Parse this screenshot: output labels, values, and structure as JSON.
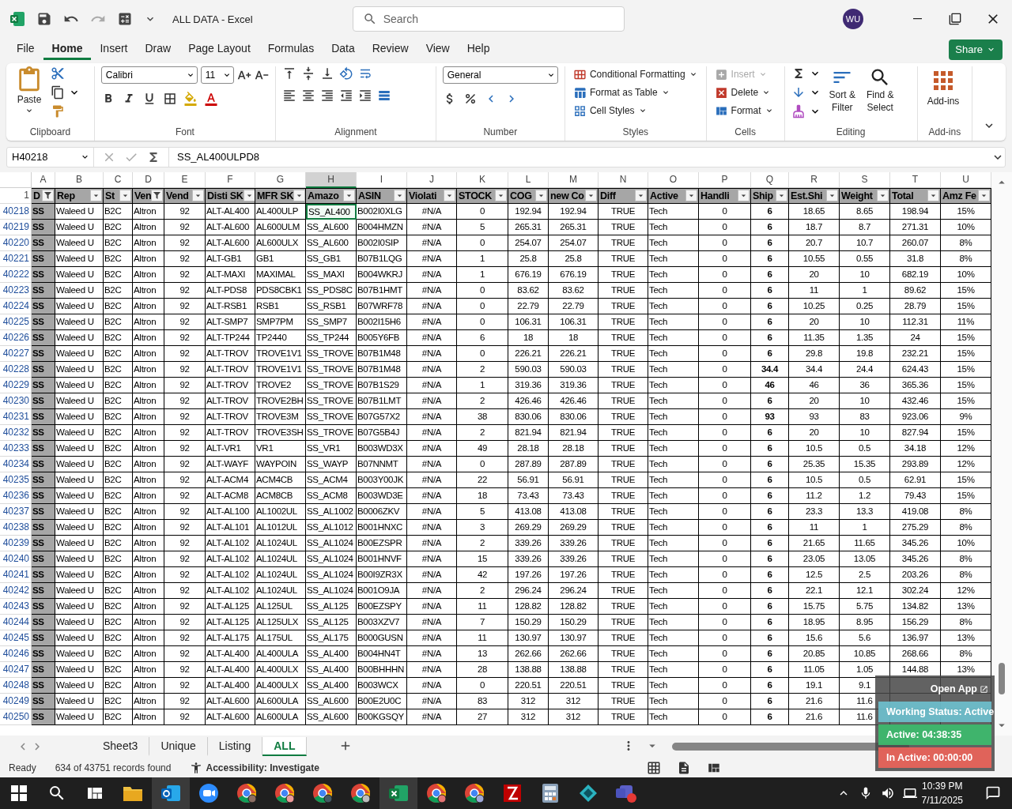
{
  "window": {
    "title": "ALL DATA - Excel",
    "search_placeholder": "Search",
    "avatar": "WU"
  },
  "menu_tabs": [
    {
      "label": "File",
      "selected": false
    },
    {
      "label": "Home",
      "selected": true
    },
    {
      "label": "Insert",
      "selected": false
    },
    {
      "label": "Draw",
      "selected": false
    },
    {
      "label": "Page Layout",
      "selected": false
    },
    {
      "label": "Formulas",
      "selected": false
    },
    {
      "label": "Data",
      "selected": false
    },
    {
      "label": "Review",
      "selected": false
    },
    {
      "label": "View",
      "selected": false
    },
    {
      "label": "Help",
      "selected": false
    }
  ],
  "share_button": "Share",
  "ribbon": {
    "clipboard": {
      "label": "Clipboard",
      "paste": "Paste"
    },
    "font": {
      "label": "Font",
      "family": "Calibri",
      "size": "11"
    },
    "alignment": {
      "label": "Alignment"
    },
    "number": {
      "label": "Number",
      "format": "General"
    },
    "styles": {
      "label": "Styles",
      "items": [
        "Conditional Formatting",
        "Format as Table",
        "Cell Styles"
      ]
    },
    "cells": {
      "label": "Cells",
      "items": [
        {
          "label": "Insert",
          "disabled": true
        },
        {
          "label": "Delete",
          "disabled": false
        },
        {
          "label": "Format",
          "disabled": false
        }
      ]
    },
    "editing": {
      "label": "Editing",
      "sort": [
        "Sort &",
        "Filter"
      ],
      "find": [
        "Find &",
        "Select"
      ]
    },
    "addins": {
      "label": "Add-ins",
      "button": "Add-ins"
    }
  },
  "formula_bar": {
    "name_box": "H40218",
    "content": "SS_AL400ULPD8"
  },
  "columns": [
    {
      "letter": "A",
      "header": "D",
      "filtered": true,
      "selected": false
    },
    {
      "letter": "B",
      "header": "Rep",
      "filtered": false,
      "selected": false
    },
    {
      "letter": "C",
      "header": "St",
      "filtered": false,
      "selected": false
    },
    {
      "letter": "D",
      "header": "Ven",
      "filtered": true,
      "selected": false
    },
    {
      "letter": "E",
      "header": "Vend",
      "filtered": false,
      "selected": false
    },
    {
      "letter": "F",
      "header": "Disti SK",
      "filtered": false,
      "selected": false
    },
    {
      "letter": "G",
      "header": "MFR SK",
      "filtered": false,
      "selected": false
    },
    {
      "letter": "H",
      "header": "Amazo",
      "filtered": false,
      "selected": true
    },
    {
      "letter": "I",
      "header": "ASIN",
      "filtered": false,
      "selected": false
    },
    {
      "letter": "J",
      "header": "Violati",
      "filtered": false,
      "selected": false
    },
    {
      "letter": "K",
      "header": "STOCK",
      "filtered": false,
      "selected": false
    },
    {
      "letter": "L",
      "header": "COG",
      "filtered": false,
      "selected": false
    },
    {
      "letter": "M",
      "header": "new Co",
      "filtered": false,
      "selected": false
    },
    {
      "letter": "N",
      "header": "Diff",
      "filtered": false,
      "selected": false
    },
    {
      "letter": "O",
      "header": "Active",
      "filtered": false,
      "selected": false
    },
    {
      "letter": "P",
      "header": "Handli",
      "filtered": false,
      "selected": false
    },
    {
      "letter": "Q",
      "header": "Ship",
      "filtered": false,
      "selected": false
    },
    {
      "letter": "R",
      "header": "Est.Shi",
      "filtered": false,
      "selected": false
    },
    {
      "letter": "S",
      "header": "Weight",
      "filtered": false,
      "selected": false
    },
    {
      "letter": "T",
      "header": "Total",
      "filtered": false,
      "selected": false
    },
    {
      "letter": "U",
      "header": "Amz Fe",
      "filtered": false,
      "selected": false
    }
  ],
  "header_row_number": "1",
  "rows": [
    {
      "num": "40218",
      "selected": true,
      "cells": [
        "SS",
        "Waleed U",
        "B2C",
        "Altron",
        "92",
        "ALT-AL400",
        "AL400ULP",
        "SS_AL400",
        "B002I0XLG",
        "#N/A",
        "0",
        "192.94",
        "192.94",
        "TRUE",
        "Tech",
        "0",
        "6",
        "18.65",
        "8.65",
        "198.94",
        "15%"
      ]
    },
    {
      "num": "40219",
      "selected": false,
      "cells": [
        "SS",
        "Waleed U",
        "B2C",
        "Altron",
        "92",
        "ALT-AL600",
        "AL600ULM",
        "SS_AL600",
        "B004HMZN",
        "#N/A",
        "5",
        "265.31",
        "265.31",
        "TRUE",
        "Tech",
        "0",
        "6",
        "18.7",
        "8.7",
        "271.31",
        "10%"
      ]
    },
    {
      "num": "40220",
      "selected": false,
      "cells": [
        "SS",
        "Waleed U",
        "B2C",
        "Altron",
        "92",
        "ALT-AL600",
        "AL600ULX",
        "SS_AL600",
        "B002I0SIP",
        "#N/A",
        "0",
        "254.07",
        "254.07",
        "TRUE",
        "Tech",
        "0",
        "6",
        "20.7",
        "10.7",
        "260.07",
        "8%"
      ]
    },
    {
      "num": "40221",
      "selected": false,
      "cells": [
        "SS",
        "Waleed U",
        "B2C",
        "Altron",
        "92",
        "ALT-GB1",
        "GB1",
        "SS_GB1",
        "B07B1LQG",
        "#N/A",
        "1",
        "25.8",
        "25.8",
        "TRUE",
        "Tech",
        "0",
        "6",
        "10.55",
        "0.55",
        "31.8",
        "8%"
      ]
    },
    {
      "num": "40222",
      "selected": false,
      "cells": [
        "SS",
        "Waleed U",
        "B2C",
        "Altron",
        "92",
        "ALT-MAXI",
        "MAXIMAL",
        "SS_MAXI",
        "B004WKRJ",
        "#N/A",
        "1",
        "676.19",
        "676.19",
        "TRUE",
        "Tech",
        "0",
        "6",
        "20",
        "10",
        "682.19",
        "10%"
      ]
    },
    {
      "num": "40223",
      "selected": false,
      "cells": [
        "SS",
        "Waleed U",
        "B2C",
        "Altron",
        "92",
        "ALT-PDS8",
        "PDS8CBK1",
        "SS_PDS8C",
        "B07B1HMT",
        "#N/A",
        "0",
        "83.62",
        "83.62",
        "TRUE",
        "Tech",
        "0",
        "6",
        "11",
        "1",
        "89.62",
        "15%"
      ]
    },
    {
      "num": "40224",
      "selected": false,
      "cells": [
        "SS",
        "Waleed U",
        "B2C",
        "Altron",
        "92",
        "ALT-RSB1",
        "RSB1",
        "SS_RSB1",
        "B07WRF78",
        "#N/A",
        "0",
        "22.79",
        "22.79",
        "TRUE",
        "Tech",
        "0",
        "6",
        "10.25",
        "0.25",
        "28.79",
        "15%"
      ]
    },
    {
      "num": "40225",
      "selected": false,
      "cells": [
        "SS",
        "Waleed U",
        "B2C",
        "Altron",
        "92",
        "ALT-SMP7",
        "SMP7PM",
        "SS_SMP7",
        "B002I15H6",
        "#N/A",
        "0",
        "106.31",
        "106.31",
        "TRUE",
        "Tech",
        "0",
        "6",
        "20",
        "10",
        "112.31",
        "11%"
      ]
    },
    {
      "num": "40226",
      "selected": false,
      "cells": [
        "SS",
        "Waleed U",
        "B2C",
        "Altron",
        "92",
        "ALT-TP244",
        "TP2440",
        "SS_TP244",
        "B005Y6FB",
        "#N/A",
        "6",
        "18",
        "18",
        "TRUE",
        "Tech",
        "0",
        "6",
        "11.35",
        "1.35",
        "24",
        "15%"
      ]
    },
    {
      "num": "40227",
      "selected": false,
      "cells": [
        "SS",
        "Waleed U",
        "B2C",
        "Altron",
        "92",
        "ALT-TROV",
        "TROVE1V1",
        "SS_TROVE",
        "B07B1M48",
        "#N/A",
        "0",
        "226.21",
        "226.21",
        "TRUE",
        "Tech",
        "0",
        "6",
        "29.8",
        "19.8",
        "232.21",
        "15%"
      ]
    },
    {
      "num": "40228",
      "selected": false,
      "cells": [
        "SS",
        "Waleed U",
        "B2C",
        "Altron",
        "92",
        "ALT-TROV",
        "TROVE1V1",
        "SS_TROVE",
        "B07B1M48",
        "#N/A",
        "2",
        "590.03",
        "590.03",
        "TRUE",
        "Tech",
        "0",
        "34.4",
        "34.4",
        "24.4",
        "624.43",
        "15%"
      ]
    },
    {
      "num": "40229",
      "selected": false,
      "cells": [
        "SS",
        "Waleed U",
        "B2C",
        "Altron",
        "92",
        "ALT-TROV",
        "TROVE2",
        "SS_TROVE",
        "B07B1S29",
        "#N/A",
        "1",
        "319.36",
        "319.36",
        "TRUE",
        "Tech",
        "0",
        "46",
        "46",
        "36",
        "365.36",
        "15%"
      ]
    },
    {
      "num": "40230",
      "selected": false,
      "cells": [
        "SS",
        "Waleed U",
        "B2C",
        "Altron",
        "92",
        "ALT-TROV",
        "TROVE2BH",
        "SS_TROVE",
        "B07B1LMT",
        "#N/A",
        "2",
        "426.46",
        "426.46",
        "TRUE",
        "Tech",
        "0",
        "6",
        "20",
        "10",
        "432.46",
        "15%"
      ]
    },
    {
      "num": "40231",
      "selected": false,
      "cells": [
        "SS",
        "Waleed U",
        "B2C",
        "Altron",
        "92",
        "ALT-TROV",
        "TROVE3M",
        "SS_TROVE",
        "B07G57X2",
        "#N/A",
        "38",
        "830.06",
        "830.06",
        "TRUE",
        "Tech",
        "0",
        "93",
        "93",
        "83",
        "923.06",
        "9%"
      ]
    },
    {
      "num": "40232",
      "selected": false,
      "cells": [
        "SS",
        "Waleed U",
        "B2C",
        "Altron",
        "92",
        "ALT-TROV",
        "TROVE3SH",
        "SS_TROVE",
        "B07G5B4J",
        "#N/A",
        "2",
        "821.94",
        "821.94",
        "TRUE",
        "Tech",
        "0",
        "6",
        "20",
        "10",
        "827.94",
        "15%"
      ]
    },
    {
      "num": "40233",
      "selected": false,
      "cells": [
        "SS",
        "Waleed U",
        "B2C",
        "Altron",
        "92",
        "ALT-VR1",
        "VR1",
        "SS_VR1",
        "B003WD3X",
        "#N/A",
        "49",
        "28.18",
        "28.18",
        "TRUE",
        "Tech",
        "0",
        "6",
        "10.5",
        "0.5",
        "34.18",
        "12%"
      ]
    },
    {
      "num": "40234",
      "selected": false,
      "cells": [
        "SS",
        "Waleed U",
        "B2C",
        "Altron",
        "92",
        "ALT-WAYF",
        "WAYPOIN",
        "SS_WAYP",
        "B07NNMT",
        "#N/A",
        "0",
        "287.89",
        "287.89",
        "TRUE",
        "Tech",
        "0",
        "6",
        "25.35",
        "15.35",
        "293.89",
        "12%"
      ]
    },
    {
      "num": "40235",
      "selected": false,
      "cells": [
        "SS",
        "Waleed U",
        "B2C",
        "Altron",
        "92",
        "ALT-ACM4",
        "ACM4CB",
        "SS_ACM4",
        "B003Y00JK",
        "#N/A",
        "22",
        "56.91",
        "56.91",
        "TRUE",
        "Tech",
        "0",
        "6",
        "10.5",
        "0.5",
        "62.91",
        "15%"
      ]
    },
    {
      "num": "40236",
      "selected": false,
      "cells": [
        "SS",
        "Waleed U",
        "B2C",
        "Altron",
        "92",
        "ALT-ACM8",
        "ACM8CB",
        "SS_ACM8",
        "B003WD3E",
        "#N/A",
        "18",
        "73.43",
        "73.43",
        "TRUE",
        "Tech",
        "0",
        "6",
        "11.2",
        "1.2",
        "79.43",
        "15%"
      ]
    },
    {
      "num": "40237",
      "selected": false,
      "cells": [
        "SS",
        "Waleed U",
        "B2C",
        "Altron",
        "92",
        "ALT-AL100",
        "AL1002UL",
        "SS_AL1002",
        "B0006ZKV",
        "#N/A",
        "5",
        "413.08",
        "413.08",
        "TRUE",
        "Tech",
        "0",
        "6",
        "23.3",
        "13.3",
        "419.08",
        "8%"
      ]
    },
    {
      "num": "40238",
      "selected": false,
      "cells": [
        "SS",
        "Waleed U",
        "B2C",
        "Altron",
        "92",
        "ALT-AL101",
        "AL1012UL",
        "SS_AL1012",
        "B001HNXC",
        "#N/A",
        "3",
        "269.29",
        "269.29",
        "TRUE",
        "Tech",
        "0",
        "6",
        "11",
        "1",
        "275.29",
        "8%"
      ]
    },
    {
      "num": "40239",
      "selected": false,
      "cells": [
        "SS",
        "Waleed U",
        "B2C",
        "Altron",
        "92",
        "ALT-AL102",
        "AL1024UL",
        "SS_AL1024",
        "B00EZSPR",
        "#N/A",
        "2",
        "339.26",
        "339.26",
        "TRUE",
        "Tech",
        "0",
        "6",
        "21.65",
        "11.65",
        "345.26",
        "10%"
      ]
    },
    {
      "num": "40240",
      "selected": false,
      "cells": [
        "SS",
        "Waleed U",
        "B2C",
        "Altron",
        "92",
        "ALT-AL102",
        "AL1024UL",
        "SS_AL1024",
        "B001HNVF",
        "#N/A",
        "15",
        "339.26",
        "339.26",
        "TRUE",
        "Tech",
        "0",
        "6",
        "23.05",
        "13.05",
        "345.26",
        "8%"
      ]
    },
    {
      "num": "40241",
      "selected": false,
      "cells": [
        "SS",
        "Waleed U",
        "B2C",
        "Altron",
        "92",
        "ALT-AL102",
        "AL1024UL",
        "SS_AL1024",
        "B00I9ZR3X",
        "#N/A",
        "42",
        "197.26",
        "197.26",
        "TRUE",
        "Tech",
        "0",
        "6",
        "12.5",
        "2.5",
        "203.26",
        "8%"
      ]
    },
    {
      "num": "40242",
      "selected": false,
      "cells": [
        "SS",
        "Waleed U",
        "B2C",
        "Altron",
        "92",
        "ALT-AL102",
        "AL1024UL",
        "SS_AL1024",
        "B001O9JA",
        "#N/A",
        "2",
        "296.24",
        "296.24",
        "TRUE",
        "Tech",
        "0",
        "6",
        "22.1",
        "12.1",
        "302.24",
        "12%"
      ]
    },
    {
      "num": "40243",
      "selected": false,
      "cells": [
        "SS",
        "Waleed U",
        "B2C",
        "Altron",
        "92",
        "ALT-AL125",
        "AL125UL",
        "SS_AL125",
        "B00EZSPY",
        "#N/A",
        "11",
        "128.82",
        "128.82",
        "TRUE",
        "Tech",
        "0",
        "6",
        "15.75",
        "5.75",
        "134.82",
        "13%"
      ]
    },
    {
      "num": "40244",
      "selected": false,
      "cells": [
        "SS",
        "Waleed U",
        "B2C",
        "Altron",
        "92",
        "ALT-AL125",
        "AL125ULX",
        "SS_AL125",
        "B003XZV7",
        "#N/A",
        "7",
        "150.29",
        "150.29",
        "TRUE",
        "Tech",
        "0",
        "6",
        "18.95",
        "8.95",
        "156.29",
        "8%"
      ]
    },
    {
      "num": "40245",
      "selected": false,
      "cells": [
        "SS",
        "Waleed U",
        "B2C",
        "Altron",
        "92",
        "ALT-AL175",
        "AL175UL",
        "SS_AL175",
        "B000GUSN",
        "#N/A",
        "11",
        "130.97",
        "130.97",
        "TRUE",
        "Tech",
        "0",
        "6",
        "15.6",
        "5.6",
        "136.97",
        "13%"
      ]
    },
    {
      "num": "40246",
      "selected": false,
      "cells": [
        "SS",
        "Waleed U",
        "B2C",
        "Altron",
        "92",
        "ALT-AL400",
        "AL400ULA",
        "SS_AL400",
        "B004HN4T",
        "#N/A",
        "13",
        "262.66",
        "262.66",
        "TRUE",
        "Tech",
        "0",
        "6",
        "20.85",
        "10.85",
        "268.66",
        "8%"
      ]
    },
    {
      "num": "40247",
      "selected": false,
      "cells": [
        "SS",
        "Waleed U",
        "B2C",
        "Altron",
        "92",
        "ALT-AL400",
        "AL400ULX",
        "SS_AL400",
        "B00BHHHN",
        "#N/A",
        "28",
        "138.88",
        "138.88",
        "TRUE",
        "Tech",
        "0",
        "6",
        "11.05",
        "1.05",
        "144.88",
        "13%"
      ]
    },
    {
      "num": "40248",
      "selected": false,
      "cells": [
        "SS",
        "Waleed U",
        "B2C",
        "Altron",
        "92",
        "ALT-AL400",
        "AL400ULX",
        "SS_AL400",
        "B003WCX",
        "#N/A",
        "0",
        "220.51",
        "220.51",
        "TRUE",
        "Tech",
        "0",
        "6",
        "19.1",
        "9.1",
        null,
        null
      ]
    },
    {
      "num": "40249",
      "selected": false,
      "cells": [
        "SS",
        "Waleed U",
        "B2C",
        "Altron",
        "92",
        "ALT-AL600",
        "AL600ULA",
        "SS_AL600",
        "B00E2U0C",
        "#N/A",
        "83",
        "312",
        "312",
        "TRUE",
        "Tech",
        "0",
        "6",
        "21.6",
        "11.6",
        null,
        null
      ]
    },
    {
      "num": "40250",
      "selected": false,
      "cells": [
        "SS",
        "Waleed U",
        "B2C",
        "Altron",
        "92",
        "ALT-AL600",
        "AL600ULA",
        "SS_AL600",
        "B00KGSQY",
        "#N/A",
        "27",
        "312",
        "312",
        "TRUE",
        "Tech",
        "0",
        "6",
        "21.6",
        "11.6",
        null,
        null
      ]
    }
  ],
  "sheet_tabs": [
    {
      "label": "Sheet3",
      "selected": false
    },
    {
      "label": "Unique",
      "selected": false
    },
    {
      "label": "Listing",
      "selected": false
    },
    {
      "label": "ALL",
      "selected": true
    }
  ],
  "status_bar": {
    "mode": "Ready",
    "records": "634 of 43751 records found",
    "accessibility": "Accessibility: Investigate"
  },
  "tracker": {
    "open_app": "Open App",
    "status": "Working Status: Active",
    "active": "Active: 04:38:35",
    "inactive": "In Active: 00:00:00"
  },
  "taskbar": {
    "time": "10:39 PM",
    "date": "7/11/2025"
  }
}
